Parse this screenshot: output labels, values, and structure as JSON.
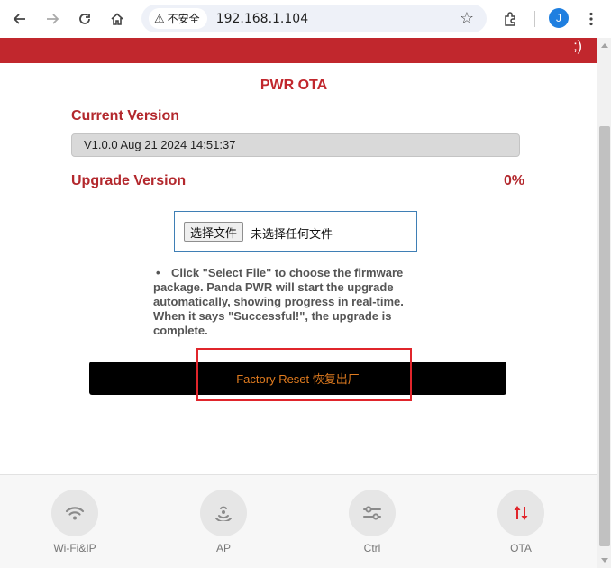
{
  "browser": {
    "security_label": "不安全",
    "url": "192.168.1.104",
    "avatar_initial": "J"
  },
  "header": {
    "smile": ";)"
  },
  "page": {
    "title": "PWR OTA",
    "current_version_label": "Current Version",
    "current_version_value": "V1.0.0 Aug 21 2024 14:51:37",
    "upgrade_version_label": "Upgrade Version",
    "progress": "0%",
    "file_button": "选择文件",
    "file_status": "未选择任何文件",
    "instructions": "Click \"Select File\" to choose the firmware package. Panda PWR will start the upgrade automatically, showing progress in real-time. When it says \"Successful!\", the upgrade is complete.",
    "reset_button": "Factory Reset 恢复出厂"
  },
  "bottom_nav": {
    "items": [
      {
        "label": "Wi-Fi&IP",
        "icon": "wifi-icon"
      },
      {
        "label": "AP",
        "icon": "broadcast-icon"
      },
      {
        "label": "Ctrl",
        "icon": "sliders-icon"
      },
      {
        "label": "OTA",
        "icon": "upgrade-icon",
        "accent": "#e0252b"
      }
    ]
  }
}
